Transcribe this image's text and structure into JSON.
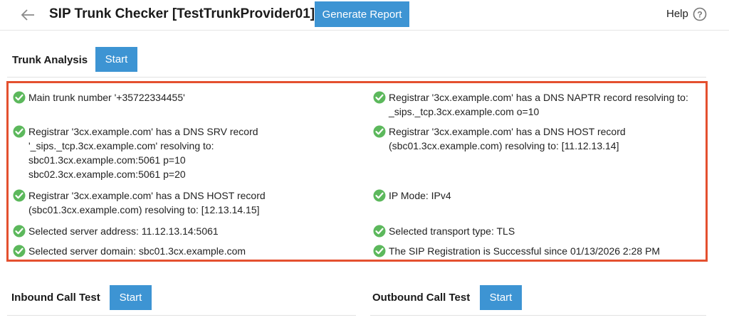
{
  "header": {
    "title": "SIP Trunk Checker [TestTrunkProvider01]",
    "generate_report_label": "Generate Report",
    "help_label": "Help",
    "icons": {
      "back": "back-arrow-icon",
      "help": "help-circle-icon"
    }
  },
  "trunk_analysis": {
    "title": "Trunk Analysis",
    "start_label": "Start",
    "results_left": [
      {
        "lines": [
          "Main trunk number '+35722334455'"
        ]
      },
      {
        "lines": [
          "Registrar '3cx.example.com' has a DNS SRV record",
          "'_sips._tcp.3cx.example.com' resolving to:",
          "sbc01.3cx.example.com:5061 p=10",
          "sbc02.3cx.example.com:5061 p=20"
        ]
      },
      {
        "lines": [
          "Registrar '3cx.example.com' has a DNS HOST record",
          "(sbc01.3cx.example.com) resolving to: [12.13.14.15]"
        ]
      },
      {
        "lines": [
          "Selected server address: 11.12.13.14:5061"
        ]
      },
      {
        "lines": [
          "Selected server domain: sbc01.3cx.example.com"
        ]
      }
    ],
    "results_right": [
      {
        "lines": [
          "Registrar '3cx.example.com' has a DNS NAPTR record resolving to:",
          "_sips._tcp.3cx.example.com o=10"
        ]
      },
      {
        "lines": [
          "Registrar '3cx.example.com' has a DNS HOST record",
          "(sbc01.3cx.example.com) resolving to: [11.12.13.14]"
        ]
      },
      {
        "lines": [
          "IP Mode: IPv4"
        ]
      },
      {
        "lines": [
          "Selected transport type: TLS"
        ]
      },
      {
        "lines": [
          "The SIP Registration is Successful since 01/13/2026 2:28 PM"
        ]
      }
    ]
  },
  "inbound_call_test": {
    "title": "Inbound Call Test",
    "start_label": "Start"
  },
  "outbound_call_test": {
    "title": "Outbound Call Test",
    "start_label": "Start"
  },
  "colors": {
    "accent_button": "#3d94d3",
    "success_check": "#5cb85c",
    "highlight_border": "#e4502f"
  }
}
